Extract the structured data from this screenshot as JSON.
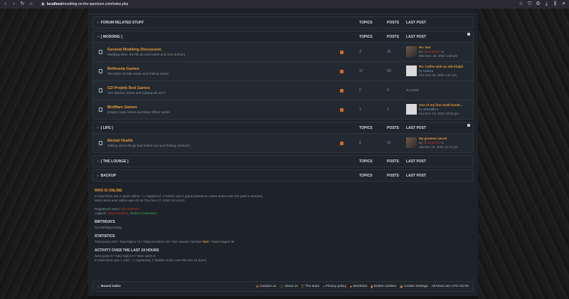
{
  "browser": {
    "url_host": "localhost",
    "url_path": "/modding-on-the-spectrum.com/index.php",
    "back_icon": "arrow-left-icon",
    "forward_icon": "arrow-right-icon",
    "reload_icon": "reload-icon",
    "home_icon": "home-icon"
  },
  "columns": {
    "topics": "TOPICS",
    "posts": "POSTS",
    "last_post": "LAST POST"
  },
  "categories": [
    {
      "name": "FORUM RELATED STUFF",
      "collapsed": true,
      "forums": []
    },
    {
      "name": "[ MODDING ]",
      "collapsed": false,
      "forums": [
        {
          "title": "General Modding Discussion",
          "desc": "Modding sites, the life as mod users and mod authors",
          "topics": "3",
          "posts": "16",
          "lp_title": "Re: test",
          "lp_by": "by",
          "lp_user": "Simon87017",
          "lp_date": "Mon Dec 19, 2022 1:58 pm",
          "avatar": "dark"
        },
        {
          "title": "Bethesda Games",
          "desc": "The Elder Scrolls series and Fallout series",
          "topics": "17",
          "posts": "93",
          "lp_title": "Re: Coffee with an old Khajiit",
          "lp_by": "by",
          "lp_user": "Aviva",
          "lp_date": "Tue Nov 29, 2022 1:07 pm",
          "avatar": "light"
        },
        {
          "title": "CD Projekt Red Games",
          "desc": "The Witcher series and Cyberpunk 2077",
          "topics": "0",
          "posts": "0",
          "no_posts": "No posts"
        },
        {
          "title": "BioWare Games",
          "desc": "Dragon Ages series and Mass Effect series",
          "topics": "1",
          "posts": "1",
          "lp_title": "One of my first multi-hundr...",
          "lp_by": "by",
          "lp_user": "simi1957",
          "lp_date": "Sun Nov 13, 2022 10:03 pm",
          "avatar": "light"
        }
      ]
    },
    {
      "name": "[ LIFE ]",
      "collapsed": false,
      "forums": [
        {
          "title": "Mental Health",
          "desc": "Talking about things that bother you and finding solutions",
          "topics": "8",
          "posts": "12",
          "lp_title": "My greatest secret",
          "lp_by": "by",
          "lp_user": "Simon87017",
          "lp_date": "Sat Dec 10, 2022 11:17 pm",
          "avatar": "dark"
        }
      ]
    },
    {
      "name": "[ THE LOUNGE ]",
      "collapsed": true,
      "forums": []
    },
    {
      "name": "BACKUP",
      "collapsed": true,
      "forums": []
    }
  ],
  "stats": {
    "online_h": "WHO IS ONLINE",
    "online_1": "In total there are 2 users online :: 1 registered, 0 hidden and 1 guest (based on users active over the past 5 minutes)",
    "online_2": "Most users ever online was 42 on Thu Nov 17, 2022 10:14 pm",
    "registered_label": "Registered users:",
    "registered_user": "Simon87017",
    "legend_label": "Legend:",
    "legend_admin": "Administrators",
    "legend_mods": "Global moderators",
    "birthdays_h": "BIRTHDAYS",
    "birthdays_t": "No birthdays today",
    "statistics_h": "STATISTICS",
    "statistics_pre": "Total posts 476 • Total topics 74 • Total members 16 • Our newest member",
    "newest_member": "test",
    "statistics_post": "• Total images 49",
    "activity_h": "ACTIVITY OVER THE LAST 24 HOURS",
    "activity_1": "New posts 0 • New topics 0 • New users 0",
    "activity_2": "In total there was 1 user :: 1 registered, 0 hidden active over the last 24 hours"
  },
  "footer": {
    "board_index": "Board index",
    "contact": "Contact us",
    "about": "About us",
    "team": "The team",
    "privacy": "Privacy policy",
    "members": "Members",
    "delete_cookies": "Delete cookies",
    "cookie_settings": "Cookie Settings",
    "times": "All times are UTC+01:00"
  },
  "colors": {
    "accent": "#e8993b",
    "admin": "#c0392b",
    "moderator": "#3fa85a"
  }
}
